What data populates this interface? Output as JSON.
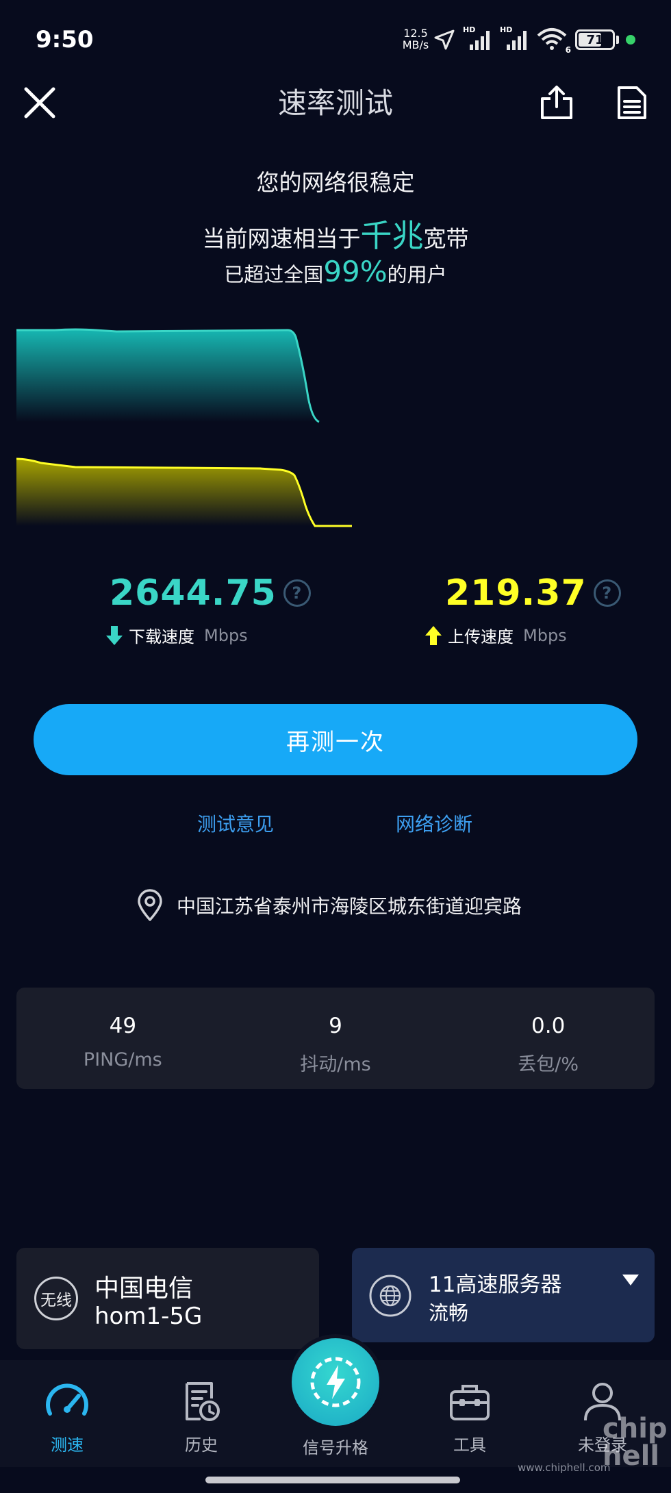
{
  "status_bar": {
    "time": "9:50",
    "net_rate": "12.5",
    "net_rate_unit": "MB/s",
    "hd1": "HD",
    "hd2": "HD",
    "wifi_badge": "6",
    "battery": "71",
    "battery_level_pct": 71
  },
  "header": {
    "title": "速率测试"
  },
  "summary": {
    "line1": "您的网络很稳定",
    "line2_prefix": "当前网速相当于",
    "line2_highlight": "千兆",
    "line2_suffix": "宽带",
    "line3_prefix": "已超过全国",
    "line3_highlight": "99%",
    "line3_suffix": "的用户"
  },
  "colors": {
    "download": "#3ad6c6",
    "upload": "#ffff26",
    "accent": "#17a9f7",
    "link": "#3d9ff0"
  },
  "download": {
    "value": "2644.75",
    "label": "下载速度",
    "unit": "Mbps"
  },
  "upload": {
    "value": "219.37",
    "label": "上传速度",
    "unit": "Mbps"
  },
  "help_glyph": "?",
  "actions": {
    "retest": "再测一次",
    "feedback": "测试意见",
    "diagnose": "网络诊断"
  },
  "location": "中国江苏省泰州市海陵区城东街道迎宾路",
  "stats": [
    {
      "value": "49",
      "label": "PING/ms"
    },
    {
      "value": "9",
      "label": "抖动/ms"
    },
    {
      "value": "0.0",
      "label": "丢包/%"
    }
  ],
  "network": {
    "badge": "无线",
    "carrier": "中国电信",
    "ssid": "hom1-5G"
  },
  "server": {
    "name": "11高速服务器",
    "status": "流畅"
  },
  "nav": {
    "speed": "测速",
    "history": "历史",
    "signal": "信号升格",
    "tools": "工具",
    "login": "未登录"
  },
  "watermark": {
    "site": "www.chiphell.com",
    "logo_line1": "chip",
    "logo_line2": "hell"
  }
}
